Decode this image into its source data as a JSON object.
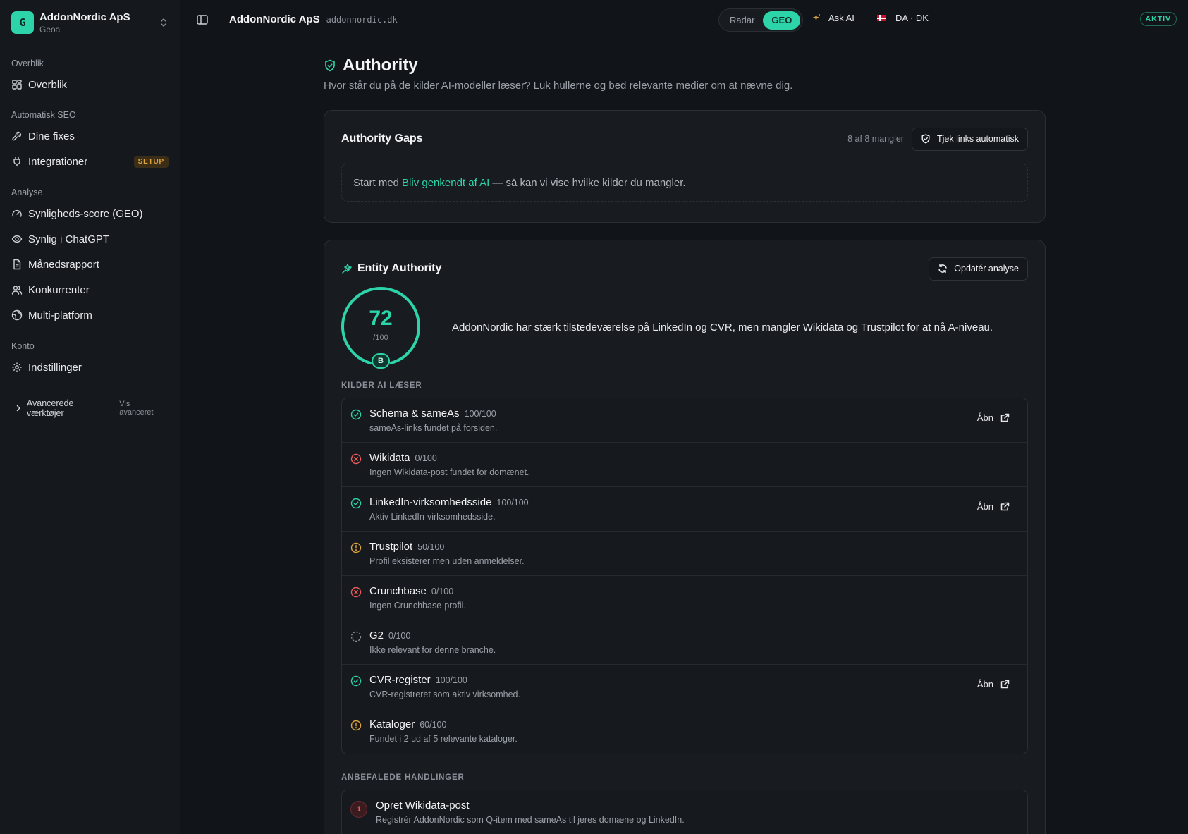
{
  "colors": {
    "accent": "#2dd4aa",
    "error": "#ef5b5b",
    "warning": "#e0a33a",
    "muted": "#8b9099"
  },
  "org": {
    "logo_letter": "G",
    "name": "AddonNordic ApS",
    "sub": "Geoa"
  },
  "sidebar": {
    "sections": [
      {
        "label": "Overblik",
        "items": [
          {
            "label": "Overblik",
            "icon": "grid-icon"
          }
        ]
      },
      {
        "label": "Automatisk SEO",
        "items": [
          {
            "label": "Dine fixes",
            "icon": "wrench-icon"
          },
          {
            "label": "Integrationer",
            "icon": "plug-icon",
            "badge": "SETUP"
          }
        ]
      },
      {
        "label": "Analyse",
        "items": [
          {
            "label": "Synligheds-score (GEO)",
            "icon": "gauge-icon"
          },
          {
            "label": "Synlig i ChatGPT",
            "icon": "eye-icon"
          },
          {
            "label": "Månedsrapport",
            "icon": "file-icon"
          },
          {
            "label": "Konkurrenter",
            "icon": "users-icon"
          },
          {
            "label": "Multi-platform",
            "icon": "globe-icon"
          }
        ]
      },
      {
        "label": "Konto",
        "items": [
          {
            "label": "Indstillinger",
            "icon": "gear-icon"
          }
        ]
      }
    ],
    "advanced": {
      "label": "Avancerede værktøjer",
      "link": "Vis avanceret"
    }
  },
  "topbar": {
    "title": "AddonNordic ApS",
    "domain": "addonnordic.dk",
    "segments": [
      "Radar",
      "GEO"
    ],
    "active_segment": "GEO",
    "ask_ai": "Ask AI",
    "language": "DA · DK",
    "status": "AKTIV"
  },
  "page": {
    "title": "Authority",
    "subtitle": "Hvor står du på de kilder AI-modeller læser? Luk hullerne og bed relevante medier om at nævne dig."
  },
  "gaps": {
    "title": "Authority Gaps",
    "count": "8 af 8 mangler",
    "button": "Tjek links automatisk",
    "empty_prefix": "Start med",
    "empty_link": "Bliv genkendt af AI",
    "empty_suffix": "— så kan vi vise hvilke kilder du mangler."
  },
  "entity": {
    "title": "Entity Authority",
    "button": "Opdatér analyse",
    "score": 72,
    "score_max_label": "/100",
    "grade": "B",
    "summary": "AddonNordic har stærk tilstedeværelse på LinkedIn og CVR, men mangler Wikidata og Trustpilot for at nå A-niveau.",
    "sources_label": "KILDER AI LÆSER",
    "open_label": "Åbn",
    "sources": [
      {
        "name": "Schema & sameAs",
        "score": "100/100",
        "desc": "sameAs-links fundet på forsiden.",
        "status": "ok",
        "open": true
      },
      {
        "name": "Wikidata",
        "score": "0/100",
        "desc": "Ingen Wikidata-post fundet for domænet.",
        "status": "error",
        "open": false
      },
      {
        "name": "LinkedIn-virksomhedsside",
        "score": "100/100",
        "desc": "Aktiv LinkedIn-virksomhedsside.",
        "status": "ok",
        "open": true
      },
      {
        "name": "Trustpilot",
        "score": "50/100",
        "desc": "Profil eksisterer men uden anmeldelser.",
        "status": "warning",
        "open": false
      },
      {
        "name": "Crunchbase",
        "score": "0/100",
        "desc": "Ingen Crunchbase-profil.",
        "status": "error",
        "open": false
      },
      {
        "name": "G2",
        "score": "0/100",
        "desc": "Ikke relevant for denne branche.",
        "status": "na",
        "open": false
      },
      {
        "name": "CVR-register",
        "score": "100/100",
        "desc": "CVR-registreret som aktiv virksomhed.",
        "status": "ok",
        "open": true
      },
      {
        "name": "Kataloger",
        "score": "60/100",
        "desc": "Fundet i 2 ud af 5 relevante kataloger.",
        "status": "warning",
        "open": false
      }
    ],
    "actions_label": "ANBEFALEDE HANDLINGER",
    "actions": [
      {
        "num": "1",
        "title": "Opret Wikidata-post",
        "desc": "Registrér AddonNordic som Q-item med sameAs til jeres domæne og LinkedIn."
      }
    ]
  }
}
